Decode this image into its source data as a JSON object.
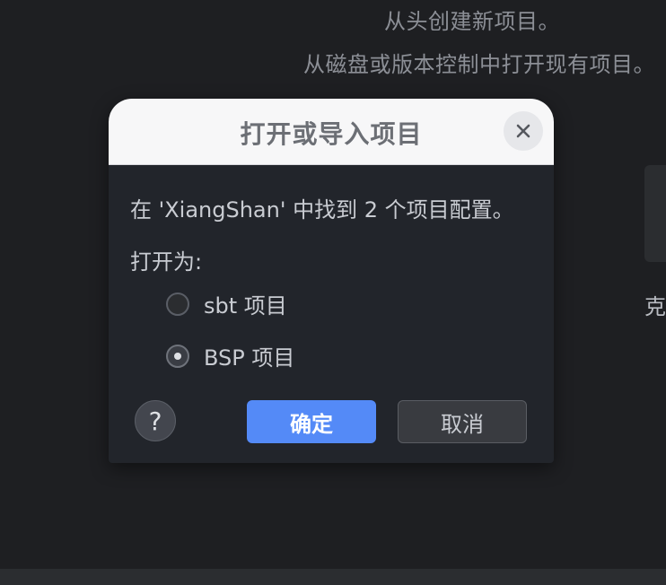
{
  "background": {
    "line1": "从头创建新项目。",
    "line2": "从磁盘或版本控制中打开现有项目。",
    "clone_label": "克"
  },
  "dialog": {
    "title": "打开或导入项目",
    "close_icon": "close-icon",
    "message": "在 'XiangShan' 中找到 2 个项目配置。",
    "open_as_label": "打开为:",
    "options": [
      {
        "label": "sbt 项目",
        "selected": false
      },
      {
        "label": "BSP 项目",
        "selected": true
      }
    ],
    "help_label": "?",
    "ok_label": "确定",
    "cancel_label": "取消"
  },
  "colors": {
    "background": "#1e1f22",
    "dialog_body": "#22252b",
    "dialog_header": "#f7f7f8",
    "primary_button": "#548af7",
    "secondary_button": "#393b40"
  }
}
